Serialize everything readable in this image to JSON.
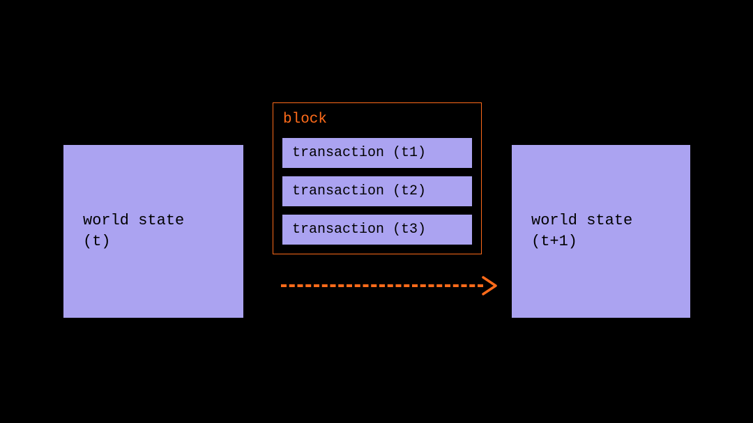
{
  "state_before": {
    "line1": "world state",
    "line2": "(t)"
  },
  "state_after": {
    "line1": "world state",
    "line2": "(t+1)"
  },
  "block": {
    "label": "block",
    "transactions": [
      "transaction (t1)",
      "transaction (t2)",
      "transaction (t3)"
    ]
  }
}
